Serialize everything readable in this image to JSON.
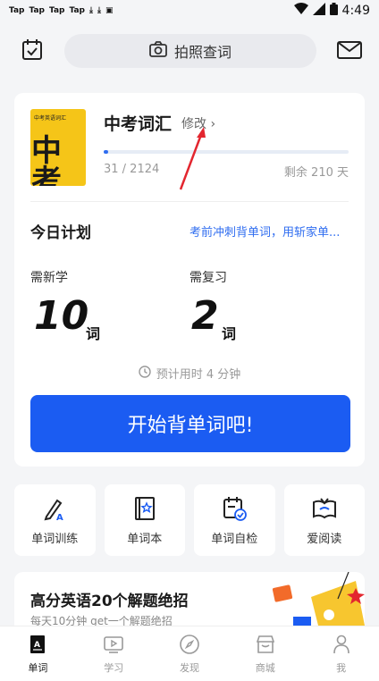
{
  "status_bar": {
    "left_items": [
      "Tap",
      "Tap",
      "Tap",
      "Tap",
      "⤓",
      "⤓",
      "▣"
    ],
    "time": "4:49"
  },
  "topbar": {
    "photo_search_label": "拍照查词"
  },
  "wordbook": {
    "cover_small_text": "中考英语词汇",
    "cover_big_text": "中考",
    "title": "中考词汇",
    "edit_label": "修改 ›",
    "progress_text": "31 / 2124",
    "progress_fraction": 0.0146,
    "remaining_text": "剩余 210 天"
  },
  "plan": {
    "title": "今日计划",
    "promo_text": "考前冲刺背单词，用斩家单...",
    "new_label": "需新学",
    "new_count": "10",
    "new_unit": "词",
    "review_label": "需复习",
    "review_count": "2",
    "review_unit": "词",
    "eta_text": "预计用时 4 分钟",
    "start_button": "开始背单词吧!"
  },
  "tools": [
    {
      "label": "单词训练",
      "icon": "pencil-a-icon"
    },
    {
      "label": "单词本",
      "icon": "star-book-icon"
    },
    {
      "label": "单词自检",
      "icon": "calendar-check-icon"
    },
    {
      "label": "爱阅读",
      "icon": "open-book-icon"
    }
  ],
  "promo": {
    "title": "高分英语20个解题绝招",
    "subtitle": "每天10分钟 get一个解题绝招"
  },
  "tabbar": [
    {
      "label": "单词",
      "active": true
    },
    {
      "label": "学习",
      "active": false
    },
    {
      "label": "发现",
      "active": false
    },
    {
      "label": "商城",
      "active": false
    },
    {
      "label": "我",
      "active": false
    }
  ],
  "colors": {
    "accent": "#1b5cf2",
    "link": "#2f6df0",
    "cover": "#f5c518",
    "annotation": "#e3262f"
  }
}
